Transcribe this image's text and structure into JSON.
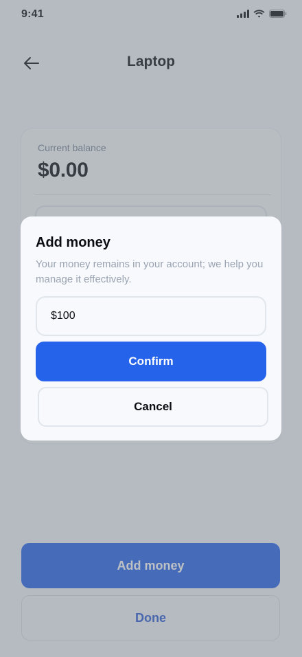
{
  "status_bar": {
    "time": "9:41",
    "icons": [
      "signal-icon",
      "wifi-icon",
      "battery-icon"
    ]
  },
  "header": {
    "back_icon": "back-arrow-icon",
    "title": "Laptop"
  },
  "balance": {
    "label": "Current balance",
    "value": "$0.00"
  },
  "actions": {
    "add_money_label": "Add money",
    "done_label": "Done"
  },
  "modal": {
    "title": "Add money",
    "description": "Your money remains in your account; we help you manage it effectively.",
    "amount_value": "$100",
    "confirm_label": "Confirm",
    "cancel_label": "Cancel"
  },
  "colors": {
    "accent": "#2563eb",
    "done_text": "#2a5bd7",
    "overlay": "rgba(110,117,127,0.46)"
  }
}
